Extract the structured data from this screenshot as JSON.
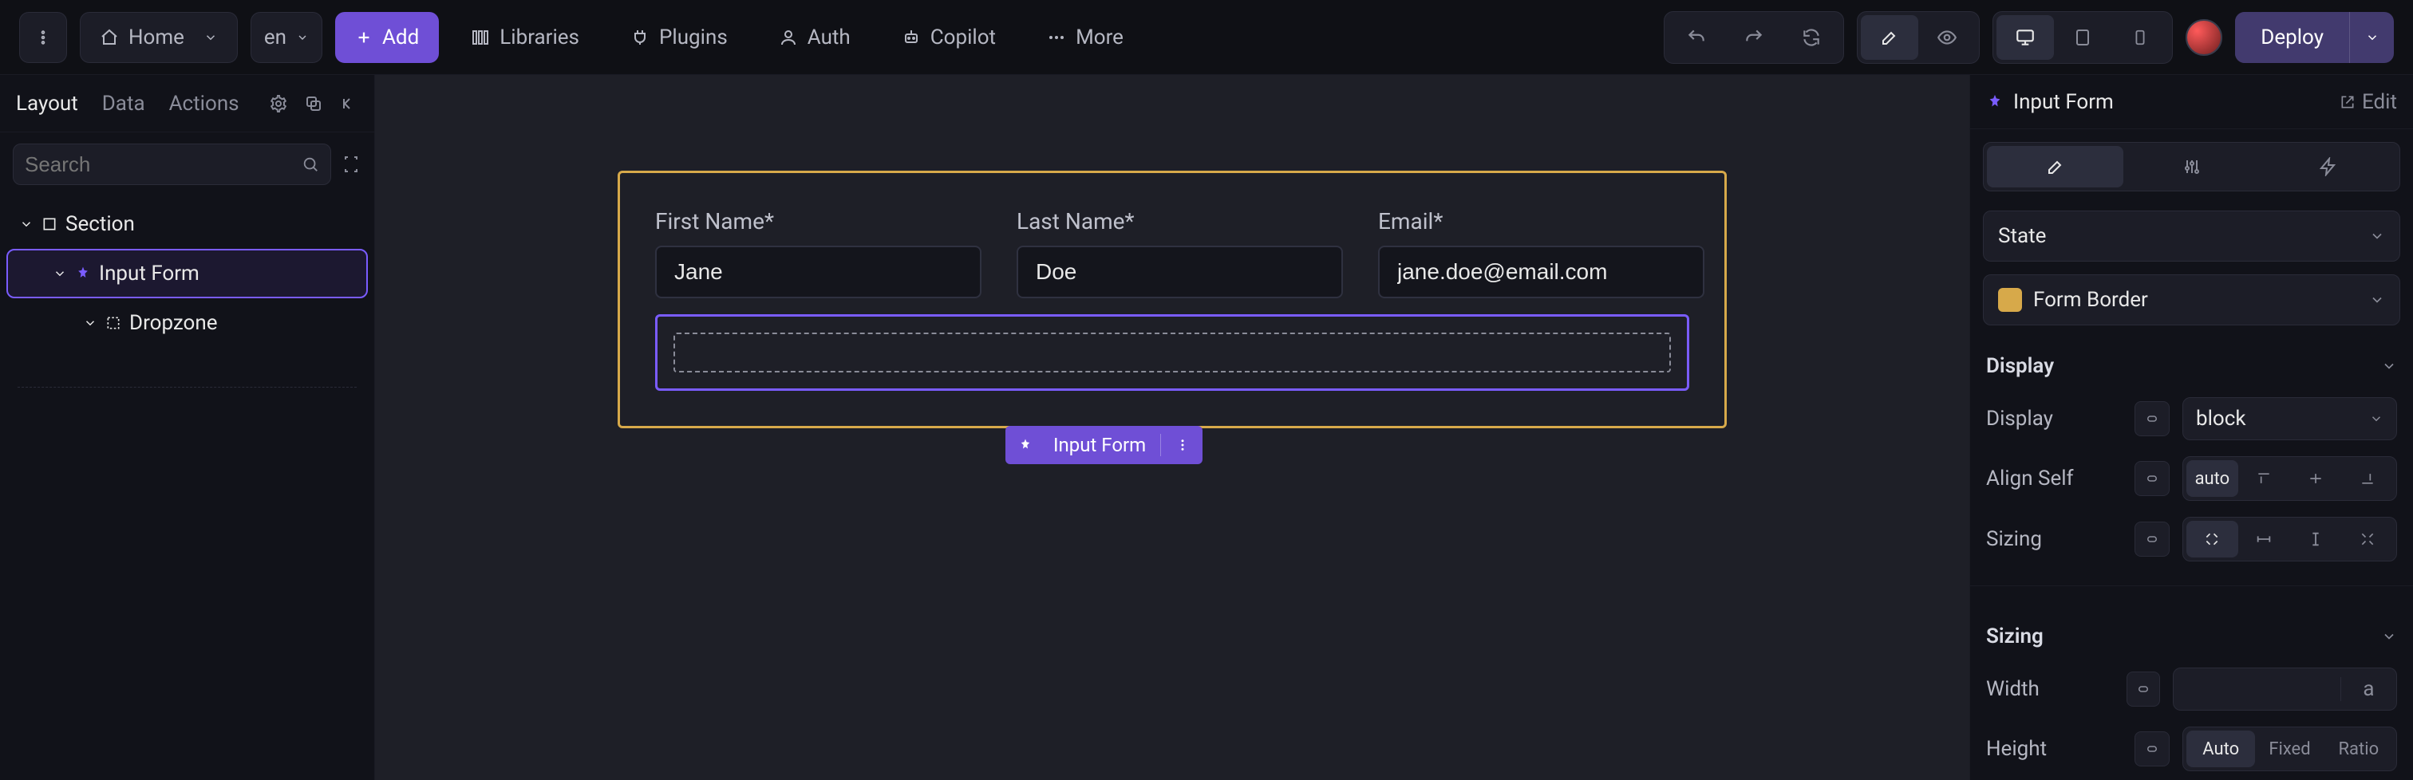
{
  "topbar": {
    "home": "Home",
    "lang": "en",
    "add": "Add",
    "libraries": "Libraries",
    "plugins": "Plugins",
    "auth": "Auth",
    "copilot": "Copilot",
    "more": "More",
    "deploy": "Deploy"
  },
  "left": {
    "tabs": {
      "layout": "Layout",
      "data": "Data",
      "actions": "Actions"
    },
    "search_placeholder": "Search"
  },
  "tree": {
    "section": "Section",
    "input_form": "Input Form",
    "dropzone": "Dropzone"
  },
  "canvas": {
    "fields": {
      "first": {
        "label": "First Name*",
        "value": "Jane"
      },
      "last": {
        "label": "Last Name*",
        "value": "Doe"
      },
      "email": {
        "label": "Email*",
        "value": "jane.doe@email.com"
      }
    },
    "selection": "Input Form"
  },
  "right": {
    "title": "Input Form",
    "edit": "Edit",
    "state": "State",
    "form_border": "Form Border",
    "display": {
      "section": "Display",
      "label": "Display",
      "value": "block"
    },
    "align_self": {
      "label": "Align Self",
      "value": "auto"
    },
    "sizing_row": {
      "label": "Sizing"
    },
    "sizing": {
      "section": "Sizing"
    },
    "width": {
      "label": "Width",
      "unit": "a"
    },
    "height": {
      "label": "Height",
      "auto": "Auto",
      "fixed": "Fixed",
      "ratio": "Ratio"
    }
  }
}
